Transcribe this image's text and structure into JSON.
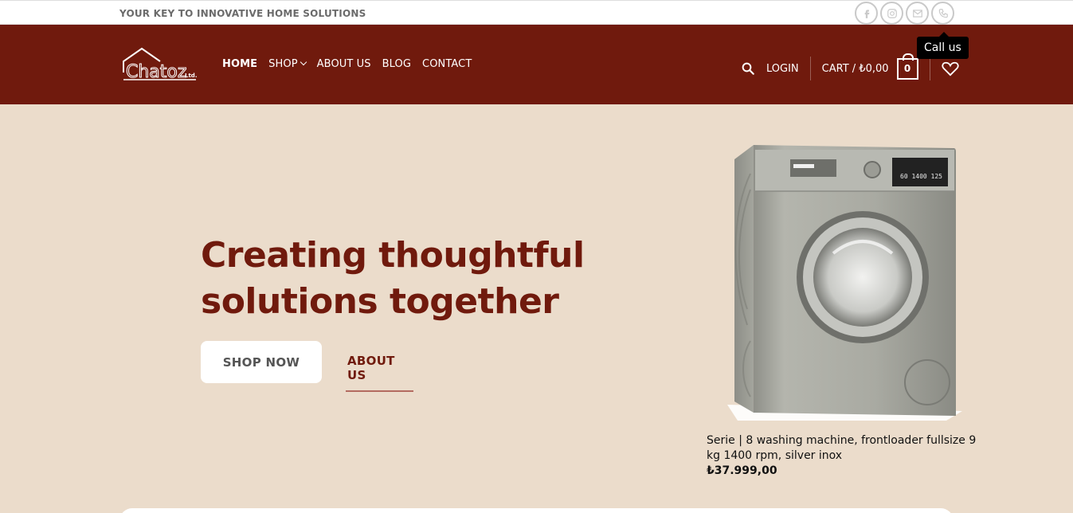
{
  "topbar": {
    "tagline": "YOUR KEY TO INNOVATIVE HOME SOLUTIONS",
    "social": [
      "facebook-icon",
      "instagram-icon",
      "email-icon",
      "phone-icon"
    ],
    "tooltip": "Call us"
  },
  "header": {
    "logo_text": "Chatoz",
    "logo_suffix": "Ltd.",
    "nav": {
      "home": "HOME",
      "shop": "SHOP",
      "about": "ABOUT US",
      "blog": "BLOG",
      "contact": "CONTACT"
    },
    "login": "LOGIN",
    "cart": "CART / ₺0,00",
    "cart_count": "0",
    "background_color": "#701a0d"
  },
  "hero": {
    "title_line1": "Creating thoughtful",
    "title_line2": "solutions together",
    "shop_button": "SHOP NOW",
    "about_button": "ABOUT US",
    "background_color": "#ebdccb"
  },
  "product": {
    "name": "Serie | 8 washing machine, frontloader fullsize 9 kg 1400 rpm, silver inox",
    "price": "₺37.999,00",
    "display_text": "60  1400  125"
  }
}
